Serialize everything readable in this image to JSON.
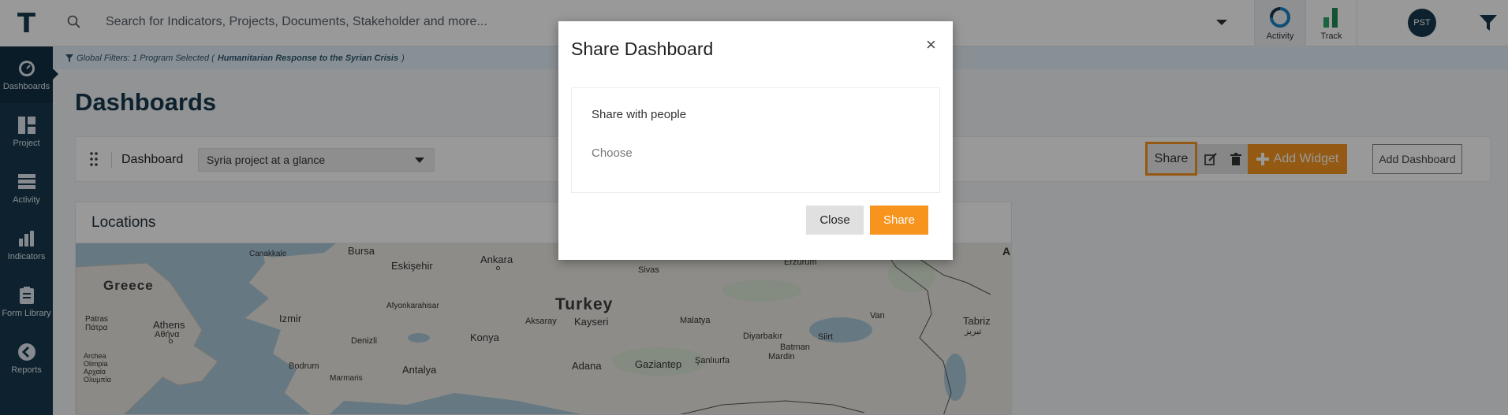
{
  "app": {
    "logo": "T"
  },
  "sidebar": {
    "items": [
      {
        "label": "Dashboards",
        "icon": "dashboard-gauge-icon"
      },
      {
        "label": "Project",
        "icon": "project-grid-icon"
      },
      {
        "label": "Activity",
        "icon": "activity-stack-icon"
      },
      {
        "label": "Indicators",
        "icon": "indicators-bar-icon"
      },
      {
        "label": "Form Library",
        "icon": "clipboard-icon"
      },
      {
        "label": "Reports",
        "icon": "reports-chevron-icon"
      }
    ]
  },
  "topbar": {
    "search_placeholder": "Search for Indicators, Projects, Documents, Stakeholder and more...",
    "activity_label": "Activity",
    "track_label": "Track",
    "avatar_initials": "PST"
  },
  "filter_strip": {
    "prefix": "Global Filters: 1 Program Selected (",
    "program": "Humanitarian Response to the Syrian Crisis",
    "suffix": ")"
  },
  "page": {
    "title": "Dashboards"
  },
  "dashboard_bar": {
    "label": "Dashboard",
    "selected": "Syria project at a glance",
    "share_label": "Share",
    "add_widget_label": "Add Widget",
    "add_dashboard_label": "Add Dashboard"
  },
  "locations": {
    "title": "Locations",
    "map_labels": {
      "greece": "Greece",
      "turkey": "Turkey",
      "bursa": "Bursa",
      "canakkale": "Canakkale",
      "eskisehir": "Eskişehir",
      "ankara": "Ankara",
      "sivas": "Sivas",
      "erzurum": "Erzurum",
      "afyon": "Afyonkarahisar",
      "izmir": "Izmir",
      "patras": "Patras",
      "patras_gr": "Πάτρα",
      "athens": "Athens",
      "athens_gr": "Αθήνα",
      "aksaray": "Aksaray",
      "kayseri": "Kayseri",
      "malatya": "Malatya",
      "van": "Van",
      "tabriz": "Tabriz",
      "tabriz_fa": "تبریز",
      "denizli": "Denizli",
      "konya": "Konya",
      "diyarbakir": "Diyarbakır",
      "siirt": "Siirt",
      "batman": "Batman",
      "mardin": "Mardin",
      "bodrum": "Bodrum",
      "antalya": "Antalya",
      "adana": "Adana",
      "gaziantep": "Gaziantep",
      "sanliurfa": "Şanlıurfa",
      "archea": "Archea",
      "olimpia": "Olimpia",
      "olimpia_gr": "Αρχαία",
      "olympia_gr": "Ολυμπία",
      "marmaris": "Marmaris",
      "edge_a": "A"
    }
  },
  "modal": {
    "title": "Share Dashboard",
    "close_symbol": "×",
    "share_with_label": "Share with people",
    "choose_placeholder": "Choose",
    "close_button": "Close",
    "share_button": "Share"
  }
}
